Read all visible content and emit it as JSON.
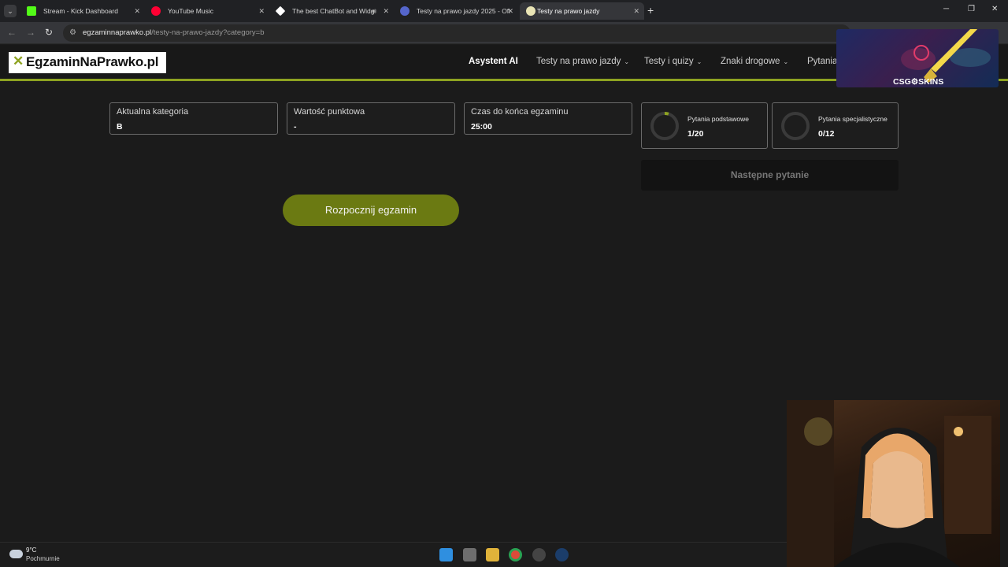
{
  "browser": {
    "tabs": [
      {
        "label": "Stream - Kick Dashboard",
        "active": false,
        "favicon_color": "#53fc18"
      },
      {
        "label": "YouTube Music",
        "active": false,
        "favicon_color": "#ff0033"
      },
      {
        "label": "The best ChatBot and Widg",
        "active": false,
        "favicon_color": "#ffffff"
      },
      {
        "label": "Testy na prawo jazdy 2025 - Ofi",
        "active": false,
        "favicon_color": "#5566cc"
      },
      {
        "label": "Testy na prawo jazdy",
        "active": true,
        "favicon_color": "#e9e4b5"
      }
    ],
    "url_host": "egzaminnaprawko.pl",
    "url_path": "/testy-na-prawo-jazdy?category=b"
  },
  "site": {
    "logo": "EgzaminNaPrawko.pl",
    "nav": [
      {
        "label": "Asystent AI",
        "dropdown": false
      },
      {
        "label": "Testy na prawo jazdy",
        "dropdown": true
      },
      {
        "label": "Testy i quizy",
        "dropdown": true
      },
      {
        "label": "Znaki drogowe",
        "dropdown": true
      },
      {
        "label": "Pytania",
        "dropdown": false
      }
    ],
    "accent_color": "#8ea321"
  },
  "ad": {
    "brand": "CSG⚙SKINS"
  },
  "exam": {
    "cards": [
      {
        "label": "Aktualna kategoria",
        "value": "B"
      },
      {
        "label": "Wartość punktowa",
        "value": "-"
      },
      {
        "label": "Czas do końca egzaminu",
        "value": "25:00"
      }
    ],
    "progress": [
      {
        "label": "Pytania podstawowe",
        "value": "1/20",
        "fraction": 0.05
      },
      {
        "label": "Pytania specjalistyczne",
        "value": "0/12",
        "fraction": 0
      }
    ],
    "next_button": "Następne pytanie",
    "start_button": "Rozpocznij egzamin"
  },
  "taskbar": {
    "temperature": "9°C",
    "weather": "Pochmurnie"
  }
}
